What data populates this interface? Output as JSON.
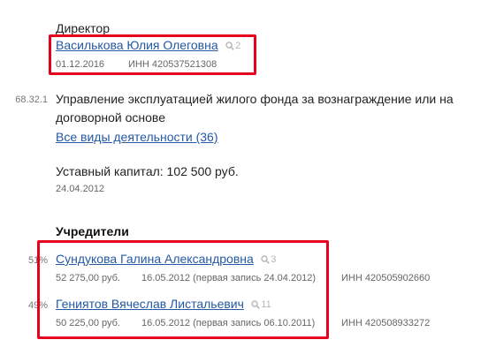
{
  "director": {
    "role": "Директор",
    "name": "Василькова Юлия Олеговна",
    "search_count": "2",
    "date": "01.12.2016",
    "inn": "ИНН 420537521308"
  },
  "activity": {
    "code": "68.32.1",
    "line1": "Управление эксплуатацией жилого фонда за вознаграждение или на",
    "line2": "договорной основе",
    "all_link": "Все виды деятельности (36)"
  },
  "capital": {
    "text": "Уставный капитал: 102 500 руб.",
    "date": "24.04.2012"
  },
  "founders": {
    "heading": "Учредители",
    "items": [
      {
        "share": "51%",
        "name": "Сундукова Галина Александровна",
        "search_count": "3",
        "amount": "52 275,00 руб.",
        "date": "16.05.2012 (первая запись 24.04.2012)",
        "inn": "ИНН 420505902660"
      },
      {
        "share": "49%",
        "name": "Гениятов Вячеслав Листальевич",
        "search_count": "11",
        "amount": "50 225,00 руб.",
        "date": "16.05.2012 (первая запись 06.10.2011)",
        "inn": "ИНН 420508933272"
      }
    ]
  },
  "colors": {
    "link": "#2458a3",
    "highlight": "#e6001e",
    "muted": "#666666"
  }
}
